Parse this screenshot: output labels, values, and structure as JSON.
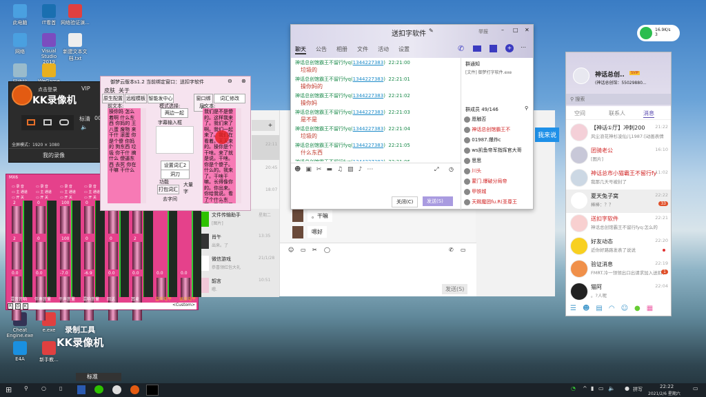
{
  "desktop": {
    "icons": [
      {
        "label": "此电脑",
        "color": "#4aa0e0"
      },
      {
        "label": "IT看首",
        "color": "#1a6fb0"
      },
      {
        "label": "网络验证演...",
        "color": "#e04040"
      },
      {
        "label": "网络",
        "color": "#4aa0e0"
      },
      {
        "label": "Visual Studio 2019",
        "color": "#7b4cbf"
      },
      {
        "label": "新建文本文档.txt",
        "color": "#eee"
      },
      {
        "label": "回收站",
        "color": "#9bc"
      },
      {
        "label": "WeGame",
        "color": "#e8b020"
      },
      {
        "label": "Cheat Engine.exe",
        "color": "#335"
      },
      {
        "label": "e.exe",
        "color": "#e04040"
      },
      {
        "label": "E4A",
        "color": "#1a90e0"
      },
      {
        "label": "新手教...",
        "color": "#e04040"
      }
    ],
    "watermark": [
      "录制工具",
      "KK录像机"
    ]
  },
  "kk": {
    "title_hint": "点击登录",
    "vip": "VIP",
    "name": "KK录像机",
    "mode": "全屏模式：1920 × 1080",
    "bottom": "我的录像",
    "side": "标清",
    "time": "00"
  },
  "tool": {
    "title": "御梦云版本s1.2 当前绑定窗口：送扣字软件",
    "menu": [
      "皮肤",
      "关于"
    ],
    "tabs": [
      "原生配置",
      "远程模板",
      "智能发中心",
      "窗口绑定",
      "词汇修改"
    ],
    "left_label": "前文本:",
    "left_text": "操你妈 怎么着啊 什么东西 你妈的 王八蛋 废物 来干什 滚蛋 你是个傻 你妈的 狗东西 垃圾 你干什 搞什么 傻逼东西 去死 你在干嘛 干什么",
    "mode_label": "模式选择:",
    "mode_value": "两边一起",
    "input_label": "字幕输入框",
    "select1": "设置词汇2",
    "select2": "洞刀",
    "func_label": "功能",
    "open_btn": "打包词汇",
    "big_label": "大量字",
    "remove_label": "去字间",
    "right_label": "后文本:",
    "right_text": "我们是不是傻的。这样我来了。我们来了啊。我们一起来了。我们在看着。天天来的。操你是个干啥。来了就是说。干啥。你是个傻子。什么的。我来了。干啥干嘛。长得像你的。你出来。你给我说。看了个什么东西。已经说了你。你要干什么的。说了。"
  },
  "mix": {
    "title": "MX6",
    "channels": [
      {
        "label": "混音音响",
        "v1": "2",
        "v2": "2",
        "v3": "0.0"
      },
      {
        "label": "伴奏音量",
        "v1": "0",
        "v2": "0",
        "v3": "0.0"
      },
      {
        "label": "干声音量",
        "v1": "100",
        "v2": "100",
        "v3": "-7.0"
      },
      {
        "label": "混响音量",
        "v1": "0",
        "v2": "0",
        "v3": "-6.9"
      },
      {
        "label": "回送",
        "v1": "0",
        "v2": "0",
        "v3": "0.0"
      },
      {
        "label": "耳麦",
        "v1": "2",
        "v2": "2",
        "v3": "0.0"
      },
      {
        "label": "监听电平",
        "v1": "",
        "v2": "",
        "v3": "0.0"
      },
      {
        "label": "录放电平",
        "v1": "",
        "v2": "",
        "v3": "0.0"
      }
    ],
    "switches": [
      "录 音",
      "主 通道",
      "开 关"
    ],
    "footer": "<Custom>",
    "rdk": [
      "R",
      "D",
      "K"
    ]
  },
  "wechat": {
    "chats": [
      {
        "name": "文件传输助手",
        "preview": "[图片]",
        "time": "星期二"
      },
      {
        "name": "肖午",
        "preview": "出来。了",
        "time": "13:35"
      },
      {
        "name": "微信游戏",
        "preview": "恭喜领红包大礼",
        "time": "21/1/28"
      },
      {
        "name": "韶言",
        "preview": "嗯.",
        "time": "10:51"
      }
    ],
    "other_times": [
      "22:11",
      "20:45",
      "18:07"
    ],
    "bubbles": [
      "。干嘛",
      "嗯好"
    ],
    "send": "发送(S)",
    "popup": "我来说"
  },
  "qqgroup": {
    "title": "送扣字软件",
    "title_icon": "edit-icon",
    "win_ctrl": "举报",
    "tabs": [
      "聊天",
      "公告",
      "相册",
      "文件",
      "活动",
      "设置"
    ],
    "messages": [
      {
        "sender": "神话总创馆霸王不留行fyq",
        "qq": "1344227383",
        "time": "22:21:00",
        "text": "垃圾的"
      },
      {
        "sender": "神话总创馆霸王不留行fyq",
        "qq": "1344227383",
        "time": "22:21:01",
        "text": "操你妈的"
      },
      {
        "sender": "神话总创馆霸王不留行fyq",
        "qq": "1344227383",
        "time": "22:21:02",
        "text": "操你妈"
      },
      {
        "sender": "神话总创馆霸王不留行fyq",
        "qq": "1344227383",
        "time": "22:21:03",
        "text": "是不是"
      },
      {
        "sender": "神话总创馆霸王不留行fyq",
        "qq": "1344227383",
        "time": "22:21:04",
        "text": "垃圾的"
      },
      {
        "sender": "神话总创馆霸王不留行fyq",
        "qq": "1344227383",
        "time": "22:21:05",
        "text": "什么东西"
      },
      {
        "sender": "神话总创馆霸王不留行fyq",
        "qq": "1344227383",
        "time": "22:21:06",
        "text": "怎么的"
      }
    ],
    "notice_title": "群通知",
    "notice_text": "[文件] 御梦打字软件.exe",
    "members_title": "群成员 49/146",
    "members": [
      {
        "name": "愿触否",
        "red": false
      },
      {
        "name": "神话总创馆霸王不",
        "red": true
      },
      {
        "name": "01987.爆炸c",
        "red": false
      },
      {
        "name": "ws凯鱼帝军指挥官大哥",
        "red": false
      },
      {
        "name": "思思",
        "red": false
      },
      {
        "name": "川头",
        "red": true
      },
      {
        "name": "蒙门.爆破分局帝",
        "red": true
      },
      {
        "name": "甲铁城",
        "red": true
      },
      {
        "name": "天赐魔团fu.R(圣尊王",
        "red": true
      }
    ],
    "close": "关闭(C)",
    "send": "发送(S)"
  },
  "qqmain": {
    "nick": "神话总创..",
    "badge": "SVIP",
    "sign": "(神话总创馆：55029880...",
    "search": "搜索",
    "tabs": [
      "空间",
      "联系人",
      "消息"
    ],
    "chats": [
      {
        "name": "【神话①厅】冲刺200",
        "preview": "风尘浪花神杉凌仙儿1987:[动画表情]",
        "time": "21:22",
        "red": false,
        "badge": "",
        "color": "#f4d0d8"
      },
      {
        "name": "团骑老公",
        "preview": "[图片]",
        "time": "16:10",
        "red": true,
        "badge": "",
        "color": "#c8c8d8"
      },
      {
        "name": "神话总市小猫霸王不留行fy",
        "preview": "我那几天号被封了",
        "time": "11:02",
        "red": true,
        "badge": "",
        "color": "#ccd8e4"
      },
      {
        "name": "夏天兔子窝",
        "preview": "棒棒：？？",
        "time": "22:22",
        "red": false,
        "badge": "33",
        "color": "#fff"
      },
      {
        "name": "送扣字软件",
        "preview": "神话总创馆霸王不留行fyq:怎么的",
        "time": "22:21",
        "red": true,
        "badge": "",
        "color": "#f8d0d0"
      },
      {
        "name": "好友动态",
        "preview": "近你好路路发表了说说",
        "time": "22:20",
        "red": false,
        "badge": "dot",
        "color": "#f8d020"
      },
      {
        "name": "验证消息",
        "preview": "FMRT.冷一领领出口出请求加入送扣字软件",
        "time": "22:19",
        "red": false,
        "badge": "1",
        "color": "#f0904a"
      },
      {
        "name": "猫阿",
        "preview": "。?人呢",
        "time": "22:04",
        "red": false,
        "badge": "",
        "color": "#222"
      }
    ]
  },
  "netwidget": {
    "speed": "16.9K/s",
    "count": "3"
  },
  "taskbar": {
    "ime": "拼写",
    "time": "22:22",
    "date": "2021/2/6 星期六",
    "lang_bar": "标准"
  },
  "colors": {
    "qq_accent": "#8f7cd8",
    "pink": "#f77ab5",
    "mix": "#e5418b"
  }
}
